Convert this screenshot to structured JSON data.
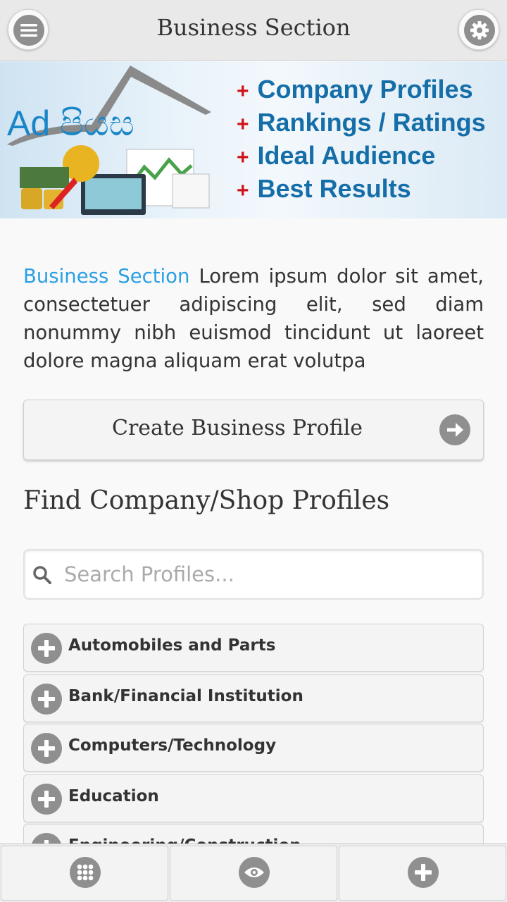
{
  "header": {
    "title": "Business Section",
    "menu_icon": "menu-icon",
    "settings_icon": "gear-icon"
  },
  "banner": {
    "logo_text": "Ad පියස",
    "features": [
      "Company Profiles",
      "Rankings / Ratings",
      "Ideal Audience",
      "Best Results"
    ],
    "plus_symbol": "+"
  },
  "intro": {
    "highlight": "Business Section",
    "text": "Lorem ipsum dolor sit amet, consectetuer adipiscing elit, sed diam nonummy nibh euismod tincidunt ut laoreet dolore magna aliquam erat volutpa"
  },
  "create_button": {
    "label": "Create Business Profile"
  },
  "find": {
    "heading": "Find Company/Shop Profiles"
  },
  "search": {
    "placeholder": "Search Profiles...",
    "value": ""
  },
  "categories": [
    {
      "label": "Automobiles and Parts"
    },
    {
      "label": "Bank/Financial Institution"
    },
    {
      "label": "Computers/Technology"
    },
    {
      "label": "Education"
    },
    {
      "label": "Engineering/Construction"
    }
  ],
  "bottom_tabs": [
    {
      "icon": "grid-icon"
    },
    {
      "icon": "eye-icon"
    },
    {
      "icon": "plus-icon"
    }
  ],
  "colors": {
    "accent": "#2a9fe6",
    "banner_text": "#156ea8",
    "banner_plus": "#d0121b",
    "icon_gray": "#8f8f8f"
  }
}
